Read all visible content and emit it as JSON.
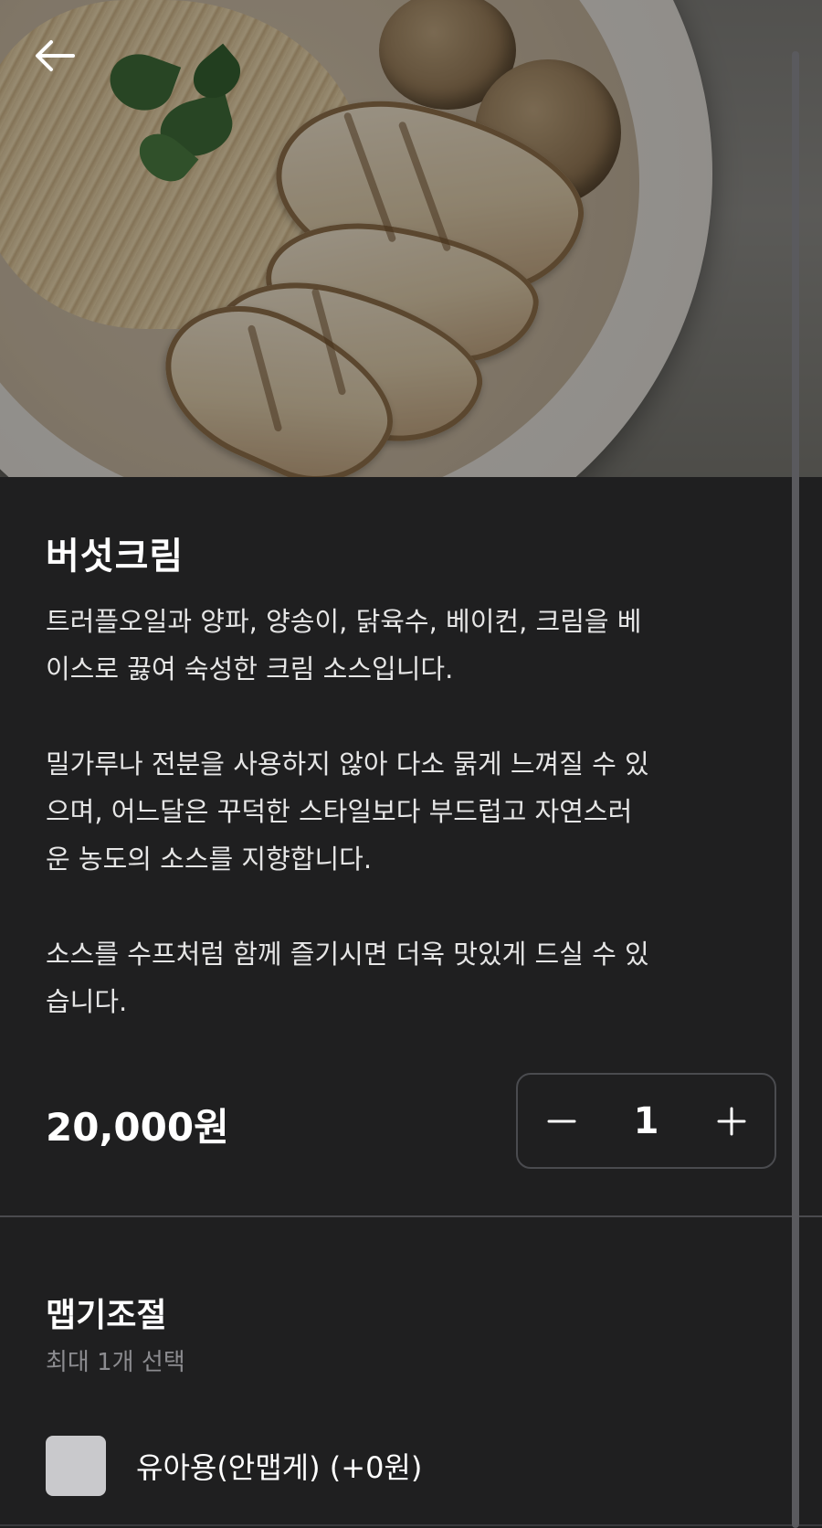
{
  "header": {
    "back_icon": "arrow-left-icon"
  },
  "menu_item": {
    "name": "버섯크림",
    "description_lines_p1": [
      "트러플오일과 양파, 양송이, 닭육수, 베이컨, 크림을 베",
      "이스로 끓여 숙성한 크림 소스입니다."
    ],
    "description_lines_p2": [
      "밀가루나 전분을 사용하지 않아 다소 묽게 느껴질 수 있",
      "으며, 어느달은 꾸덕한 스타일보다 부드럽고 자연스러",
      "운 농도의 소스를 지향합니다."
    ],
    "description_lines_p3": [
      "소스를 수프처럼 함께 즐기시면 더욱 맛있게 드실 수 있",
      "습니다."
    ],
    "price": "20,000원"
  },
  "quantity": {
    "value": "1",
    "decrement_icon": "minus-icon",
    "increment_icon": "plus-icon"
  },
  "option_group": {
    "title": "맵기조절",
    "subtitle": "최대 1개 선택",
    "options": [
      {
        "label": "유아용(안맵게) (+0원)",
        "checked": false
      }
    ]
  },
  "colors": {
    "background": "#1f1f20",
    "text": "#ffffff",
    "muted": "#8c8c90",
    "checkbox": "#c9c9cc",
    "divider": "#4a4a4e"
  }
}
